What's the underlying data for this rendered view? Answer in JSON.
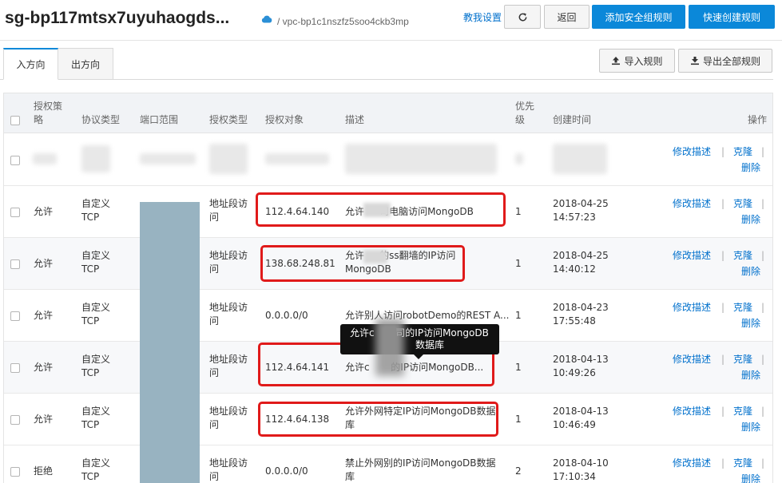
{
  "header": {
    "title": "sg-bp117mtsx7uyuhaogds...",
    "vpc": "/ vpc-bp1c1nszfz5soo4ckb3mp",
    "teach_link": "教我设置",
    "back_label": "返回",
    "add_rule_label": "添加安全组规则",
    "quick_rule_label": "快速创建规则"
  },
  "tabs": [
    {
      "label": "入方向",
      "active": true
    },
    {
      "label": "出方向",
      "active": false
    }
  ],
  "toolbar": {
    "import_label": "导入规则",
    "export_label": "导出全部规则"
  },
  "table": {
    "headers": {
      "policy_a": "授权策",
      "policy_b": "略",
      "protocol": "协议类型",
      "port": "端口范围",
      "auth_type": "授权类型",
      "auth_obj": "授权对象",
      "desc": "描述",
      "prio_a": "优先",
      "prio_b": "级",
      "created": "创建时间",
      "action": "操作"
    },
    "rows": [
      {
        "policy": "",
        "protocol_a": "",
        "protocol_b": "",
        "auth_type_a": "",
        "auth_type_b": "",
        "object": "",
        "desc_a": "",
        "desc_b": "",
        "priority": "",
        "date": "",
        "time": ""
      },
      {
        "policy": "允许",
        "protocol_a": "自定义",
        "protocol_b": "TCP",
        "auth_type_a": "地址段访",
        "auth_type_b": "问",
        "object": "112.4.64.140",
        "desc_a": "允许     司电脑访问MongoDB",
        "desc_b": "",
        "priority": "1",
        "date": "2018-04-25",
        "time": "14:57:23"
      },
      {
        "policy": "允许",
        "protocol_a": "自定义",
        "protocol_b": "TCP",
        "auth_type_a": "地址段访",
        "auth_type_b": "问",
        "object": "138.68.248.81",
        "desc_a": "允许     的ss翻墙的IP访问",
        "desc_b": "MongoDB",
        "priority": "1",
        "date": "2018-04-25",
        "time": "14:40:12"
      },
      {
        "policy": "允许",
        "protocol_a": "自定义",
        "protocol_b": "TCP",
        "auth_type_a": "地址段访",
        "auth_type_b": "问",
        "object": "0.0.0.0/0",
        "desc_a": "允许别人访问robotDemo的REST A...",
        "desc_b": "",
        "priority": "1",
        "date": "2018-04-23",
        "time": "17:55:48"
      },
      {
        "policy": "允许",
        "protocol_a": "自定义",
        "protocol_b": "TCP",
        "auth_type_a": "地址段访",
        "auth_type_b": "问",
        "object": "112.4.64.141",
        "desc_a": "允许c       的IP访问MongoDB...",
        "desc_b": "",
        "priority": "1",
        "date": "2018-04-13",
        "time": "10:49:26"
      },
      {
        "policy": "允许",
        "protocol_a": "自定义",
        "protocol_b": "TCP",
        "auth_type_a": "地址段访",
        "auth_type_b": "问",
        "object": "112.4.64.138",
        "desc_a": "允许外网特定IP访问MongoDB数据",
        "desc_b": "库",
        "priority": "1",
        "date": "2018-04-13",
        "time": "10:46:49"
      },
      {
        "policy": "拒绝",
        "protocol_a": "自定义",
        "protocol_b": "TCP",
        "auth_type_a": "地址段访",
        "auth_type_b": "问",
        "object": "0.0.0.0/0",
        "desc_a": "禁止外网别的IP访问MongoDB数据",
        "desc_b": "库",
        "priority": "2",
        "date": "2018-04-10",
        "time": "17:10:34"
      }
    ],
    "actions": {
      "edit": "修改描述",
      "sep": "|",
      "clone": "克隆",
      "delete": "删除"
    }
  },
  "tooltip": {
    "line1": "允许c       司的IP访问MongoDB",
    "line2": "数据库"
  },
  "colors": {
    "primary": "#0b88d9",
    "link": "#0070cc",
    "highlight": "#e01a1a",
    "port_block": "#98b3c1"
  }
}
